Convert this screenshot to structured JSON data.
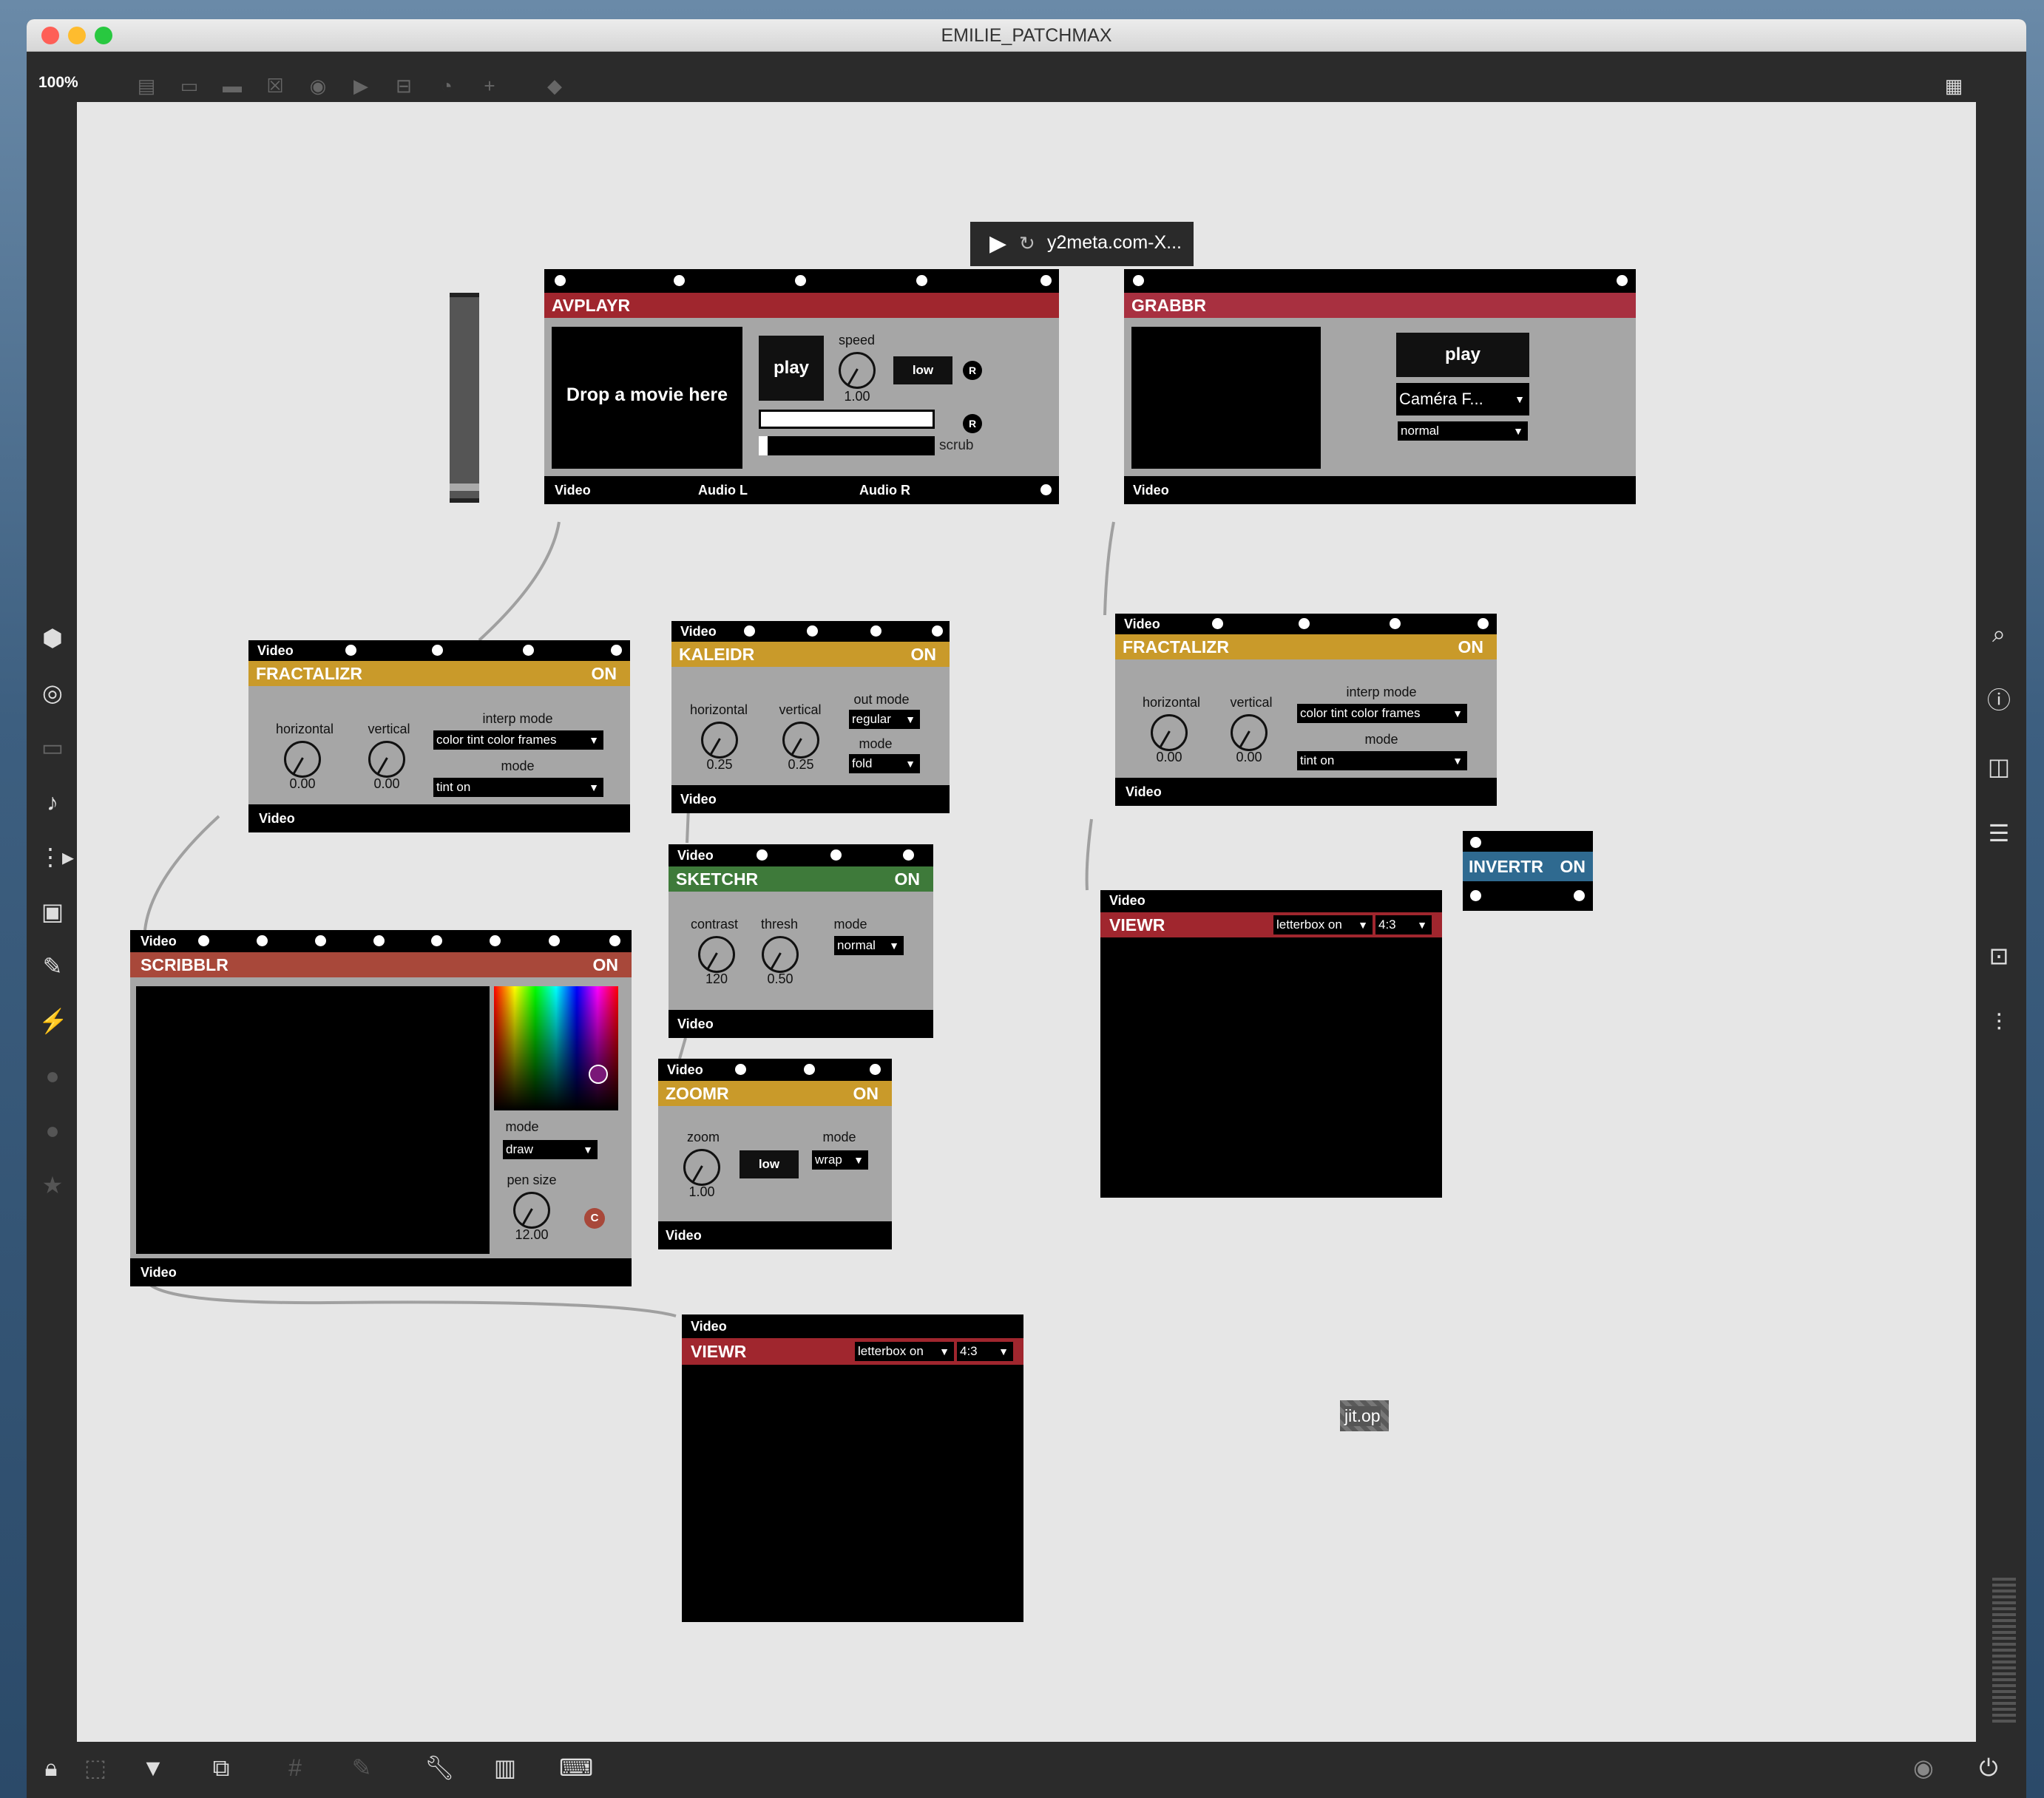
{
  "window": {
    "title": "EMILIE_PATCHMAX",
    "zoom": "100%"
  },
  "player": {
    "filename": "y2meta.com-X..."
  },
  "avplayr": {
    "title": "AVPLAYR",
    "drop": "Drop a movie here",
    "play": "play",
    "speed_label": "speed",
    "speed": "1.00",
    "low": "low",
    "r": "R",
    "scrub": "scrub",
    "out_video": "Video",
    "out_audio_l": "Audio L",
    "out_audio_r": "Audio R"
  },
  "grabbr": {
    "title": "GRABBR",
    "play": "play",
    "camera": "Caméra F...",
    "mode": "normal",
    "out_video": "Video"
  },
  "fract1": {
    "in": "Video",
    "title": "FRACTALIZR",
    "on": "ON",
    "h": "horizontal",
    "v": "vertical",
    "hv": "0.00",
    "vv": "0.00",
    "interp": "interp mode",
    "interp_val": "color tint color frames",
    "mode": "mode",
    "mode_val": "tint on",
    "out": "Video"
  },
  "kaleidr": {
    "in": "Video",
    "title": "KALEIDR",
    "on": "ON",
    "h": "horizontal",
    "v": "vertical",
    "hv": "0.25",
    "vv": "0.25",
    "outmode": "out mode",
    "outmode_val": "regular",
    "mode": "mode",
    "mode_val": "fold",
    "out": "Video"
  },
  "fract2": {
    "in": "Video",
    "title": "FRACTALIZR",
    "on": "ON",
    "h": "horizontal",
    "v": "vertical",
    "hv": "0.00",
    "vv": "0.00",
    "interp": "interp mode",
    "interp_val": "color tint color frames",
    "mode": "mode",
    "mode_val": "tint on",
    "out": "Video"
  },
  "sketchr": {
    "in": "Video",
    "title": "SKETCHR",
    "on": "ON",
    "c": "contrast",
    "t": "thresh",
    "m": "mode",
    "cv": "120",
    "tv": "0.50",
    "mode_val": "normal",
    "out": "Video"
  },
  "invertr": {
    "title": "INVERTR",
    "on": "ON"
  },
  "scribblr": {
    "in": "Video",
    "title": "SCRIBBLR",
    "on": "ON",
    "mode": "mode",
    "mode_val": "draw",
    "pen": "pen size",
    "pen_val": "12.00",
    "c": "C",
    "out": "Video"
  },
  "zoomr": {
    "in": "Video",
    "title": "ZOOMR",
    "on": "ON",
    "zoom": "zoom",
    "zoom_val": "1.00",
    "low": "low",
    "mode": "mode",
    "mode_val": "wrap",
    "out": "Video"
  },
  "viewr1": {
    "in": "Video",
    "title": "VIEWR",
    "letterbox": "letterbox on",
    "ratio": "4:3"
  },
  "viewr2": {
    "in": "Video",
    "title": "VIEWR",
    "letterbox": "letterbox on",
    "ratio": "4:3"
  },
  "jitop": {
    "label": "jit.op"
  },
  "colors": {
    "red": "#a0262e",
    "yellow": "#c99a2a",
    "green": "#3e7a3a",
    "scribred": "#a8483a",
    "blue": "#2f6a90",
    "grabbr": "#a83040"
  }
}
